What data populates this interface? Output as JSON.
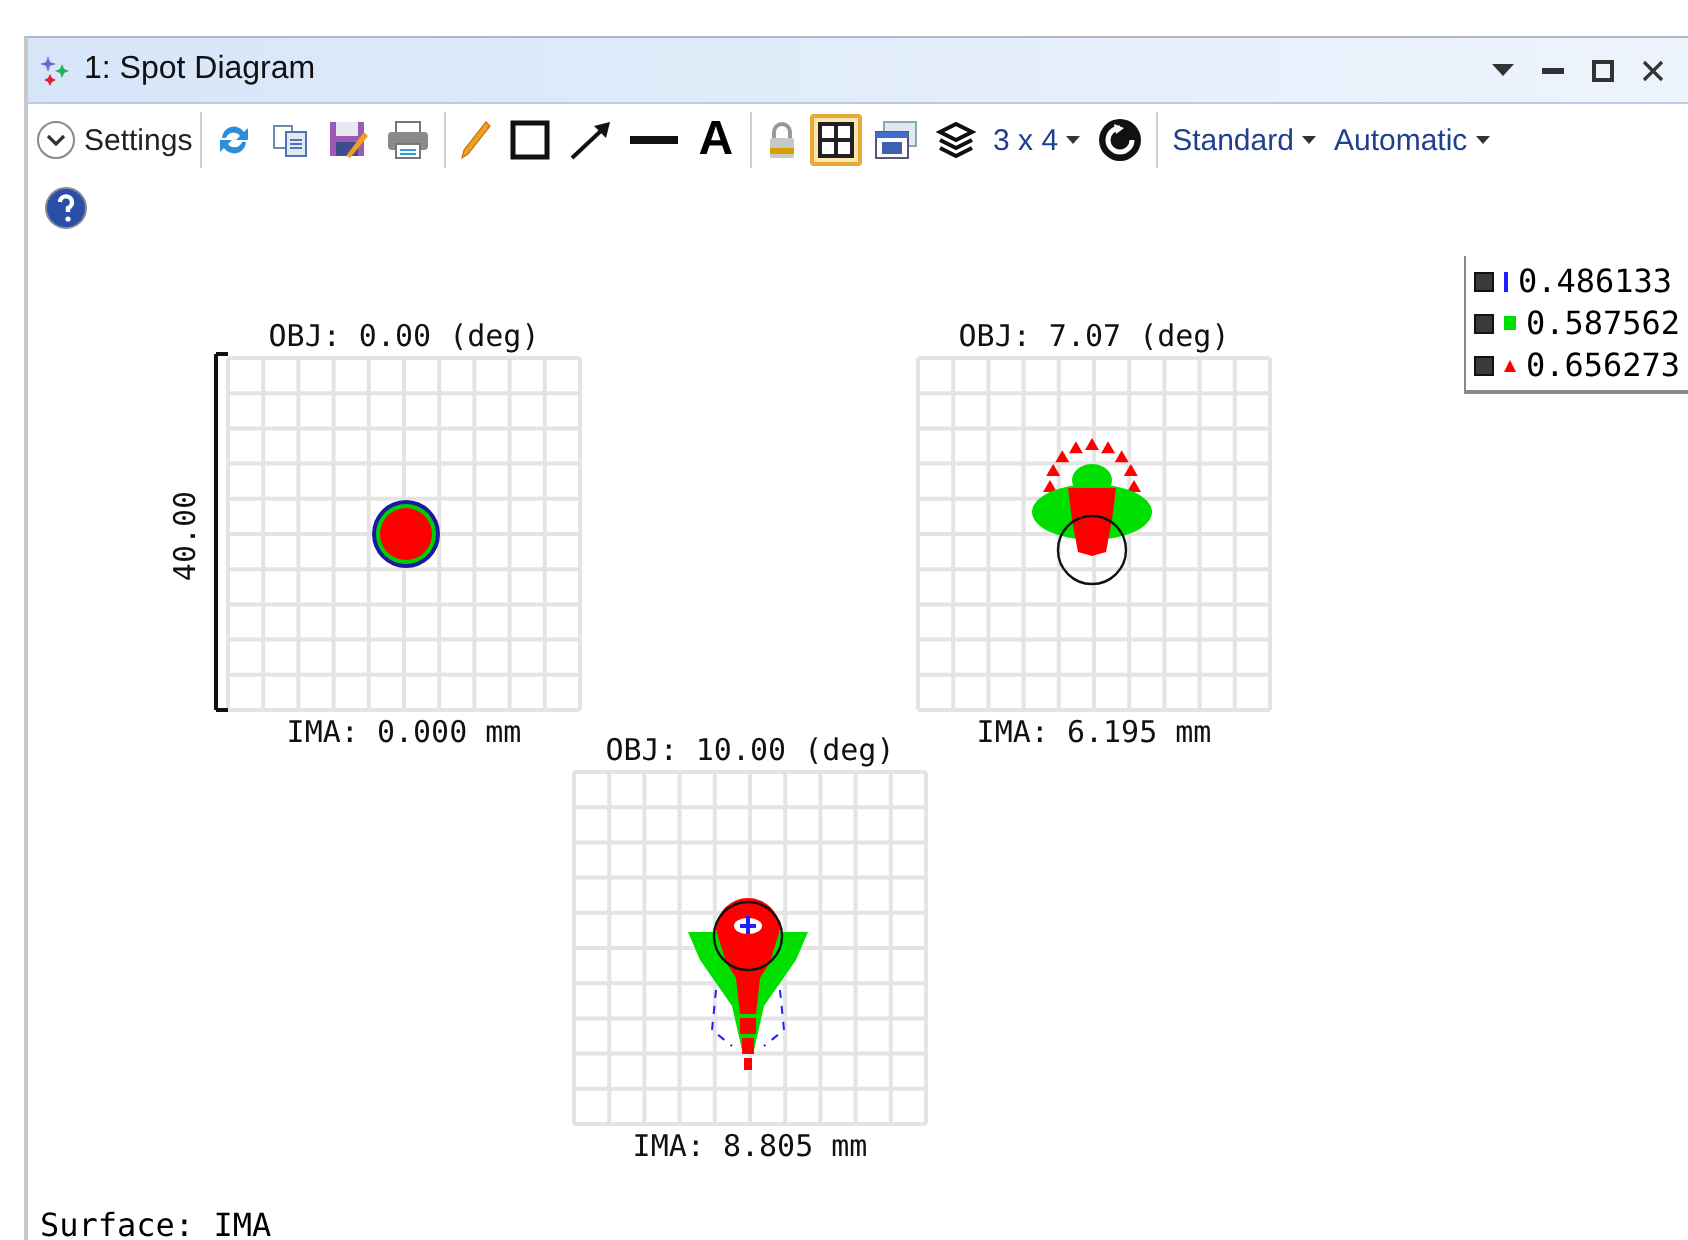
{
  "window": {
    "title": "1: Spot Diagram"
  },
  "toolbar": {
    "settings": "Settings",
    "groups": [
      [
        {
          "kind": "refresh",
          "selected": false
        },
        {
          "kind": "copy",
          "selected": false
        },
        {
          "kind": "save",
          "selected": false
        },
        {
          "kind": "print",
          "selected": false
        }
      ],
      [
        {
          "kind": "pencil",
          "selected": false
        },
        {
          "kind": "rectangle",
          "selected": false
        },
        {
          "kind": "arrow",
          "selected": false
        },
        {
          "kind": "line",
          "selected": false
        },
        {
          "kind": "text",
          "label": "A",
          "selected": false
        }
      ],
      [
        {
          "kind": "lock",
          "selected": false
        },
        {
          "kind": "grid",
          "selected": true
        },
        {
          "kind": "window",
          "selected": false
        },
        {
          "kind": "layers",
          "selected": false
        },
        {
          "kind": "layout",
          "label": "3 x 4",
          "selected": false
        },
        {
          "kind": "rotate",
          "selected": false
        }
      ]
    ],
    "dropdowns": [
      "Standard",
      "Automatic"
    ]
  },
  "legend": [
    {
      "wavelength": "0.486133",
      "color": "#2020ff",
      "kind": "tick"
    },
    {
      "wavelength": "0.587562",
      "color": "#00e000",
      "kind": "square"
    },
    {
      "wavelength": "0.656273",
      "color": "#ff0000",
      "kind": "triangle"
    }
  ],
  "plots": [
    {
      "title": "OBJ: 0.00 (deg)",
      "image_height": "IMA: 0.000 mm"
    },
    {
      "title": "OBJ: 7.07 (deg)",
      "image_height": "IMA: 6.195 mm"
    },
    {
      "title": "OBJ: 10.00 (deg)",
      "image_height": "IMA: 8.805 mm"
    }
  ],
  "scale_bar": "40.00",
  "surface": "Surface: IMA"
}
